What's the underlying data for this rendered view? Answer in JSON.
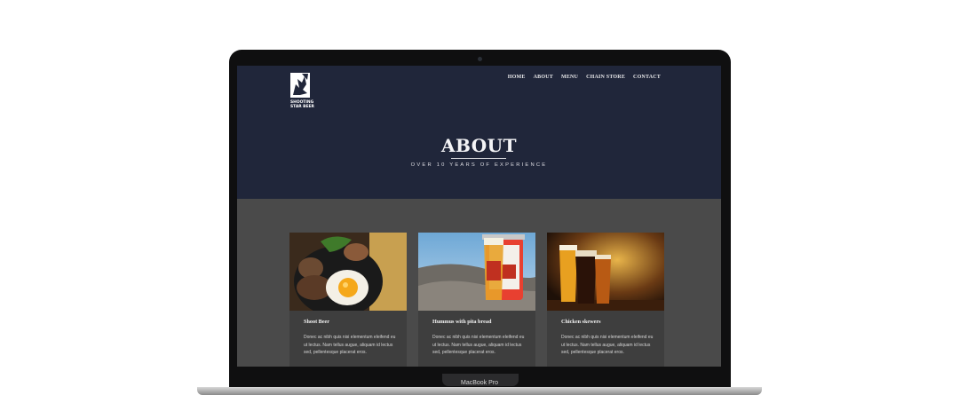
{
  "device": {
    "label": "MacBook Pro"
  },
  "site": {
    "logo_text": "SHOOTING STAR BEER",
    "nav": [
      "HOME",
      "ABOUT",
      "MENU",
      "CHAIN STORE",
      "CONTACT"
    ]
  },
  "hero": {
    "title": "ABOUT",
    "subtitle": "OVER 10 YEARS OF EXPERIENCE"
  },
  "cards": [
    {
      "title": "Shoot Beer",
      "body": "Donec ac nibh quis nisi elementum eleifend eu ut lectus. Nam tellus augue, aliquam id lectus sed, pellentesque placerat eros."
    },
    {
      "title": "Hummus with pita bread",
      "body": "Donec ac nibh quis nisi elementum eleifend eu ut lectus. Nam tellus augue, aliquam id lectus sed, pellentesque placerat eros."
    },
    {
      "title": "Chicken skewers",
      "body": "Donec ac nibh quis nisi elementum eleifend eu ut lectus. Nam tellus augue, aliquam id lectus sed, pellentesque placerat eros."
    }
  ],
  "colors": {
    "hero_bg": "#20263a",
    "content_bg": "#4a4a4a",
    "card_bg": "#3e3e3e"
  }
}
